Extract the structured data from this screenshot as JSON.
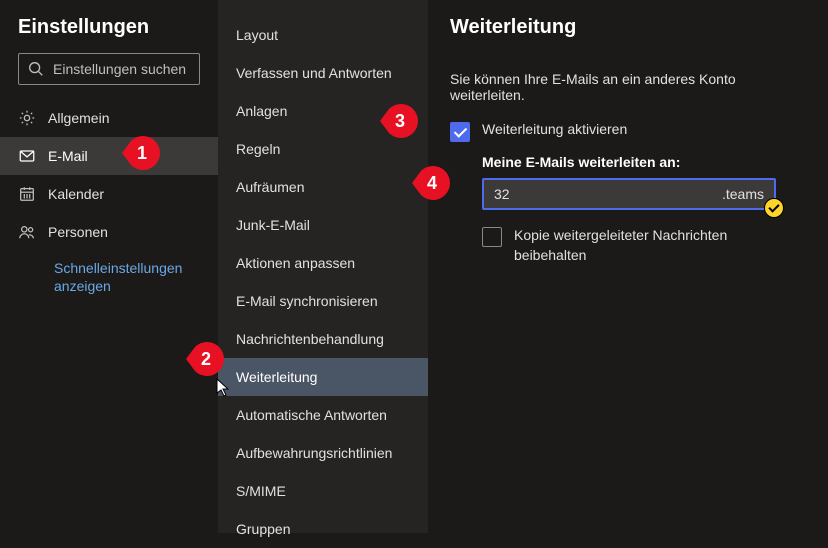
{
  "col1": {
    "title": "Einstellungen",
    "search_placeholder": "Einstellungen suchen",
    "items": [
      {
        "label": "Allgemein",
        "icon": "gear-icon",
        "selected": false
      },
      {
        "label": "E-Mail",
        "icon": "mail-icon",
        "selected": true
      },
      {
        "label": "Kalender",
        "icon": "calendar-icon",
        "selected": false
      },
      {
        "label": "Personen",
        "icon": "people-icon",
        "selected": false
      }
    ],
    "quick_link": "Schnelleinstellungen anzeigen"
  },
  "col2": {
    "items": [
      {
        "label": "Layout"
      },
      {
        "label": "Verfassen und Antworten"
      },
      {
        "label": "Anlagen"
      },
      {
        "label": "Regeln"
      },
      {
        "label": "Aufräumen"
      },
      {
        "label": "Junk-E-Mail"
      },
      {
        "label": "Aktionen anpassen"
      },
      {
        "label": "E-Mail synchronisieren"
      },
      {
        "label": "Nachrichtenbehandlung"
      },
      {
        "label": "Weiterleitung",
        "selected": true
      },
      {
        "label": "Automatische Antworten"
      },
      {
        "label": "Aufbewahrungsrichtlinien"
      },
      {
        "label": "S/MIME"
      },
      {
        "label": "Gruppen"
      }
    ]
  },
  "col3": {
    "heading": "Weiterleitung",
    "description": "Sie können Ihre E-Mails an ein anderes Konto weiterleiten.",
    "enable_label": "Weiterleitung aktivieren",
    "enable_checked": true,
    "forward_to_label": "Meine E-Mails weiterleiten an:",
    "forward_value_prefix": "32",
    "forward_value_suffix": ".teams",
    "keep_copy_label": "Kopie weitergeleiteter Nachrichten beibehalten",
    "keep_copy_checked": false
  },
  "annotations": {
    "pin1": "1",
    "pin2": "2",
    "pin3": "3",
    "pin4": "4"
  },
  "colors": {
    "accent": "#4f6bed",
    "pin": "#e81123"
  }
}
